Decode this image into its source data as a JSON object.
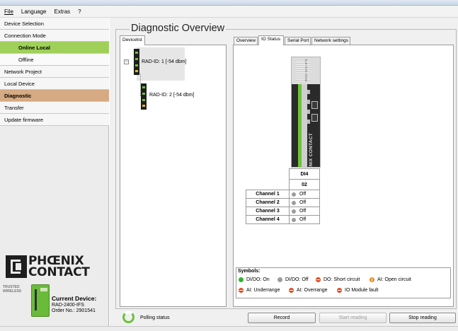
{
  "menu": [
    "File",
    "Language",
    "Extras",
    "?"
  ],
  "sidebar": {
    "items": [
      {
        "label": "Device Selection"
      },
      {
        "label": "Connection Mode"
      },
      {
        "label": "Online Local"
      },
      {
        "label": "Offline"
      },
      {
        "label": "Network Project"
      },
      {
        "label": "Local Device"
      },
      {
        "label": "Diagnostic"
      },
      {
        "label": "Transfer"
      },
      {
        "label": "Update firmware"
      }
    ],
    "logo": {
      "line1": "PHŒNIX",
      "line2": "CONTACT",
      "tagline": "TRUSTED WIRELESS"
    },
    "current_device": {
      "title": "Current Device:",
      "model": "RAD-2400-IFS",
      "order": "Order No.: 2901541"
    }
  },
  "main": {
    "title": "Diagnostic Overview",
    "devicelist_tab": "Devicelist",
    "tree": [
      {
        "label": "RAD-ID: 1 [-54 dbm]"
      },
      {
        "label": "RAD-ID: 2 [-54 dbm]"
      }
    ],
    "tabs": [
      {
        "label": "Overview"
      },
      {
        "label": "IO Status"
      },
      {
        "label": "Serial Port"
      },
      {
        "label": "Network settings"
      }
    ],
    "module": {
      "model_text": "RAD-DI4-IFS",
      "brand": "PHOENIX CONTACT"
    },
    "io_table": {
      "module_name": "DI4",
      "slot": "02",
      "channels": [
        {
          "name": "Channel 1",
          "state": "Off"
        },
        {
          "name": "Channel 2",
          "state": "Off"
        },
        {
          "name": "Channel 3",
          "state": "Off"
        },
        {
          "name": "Channel 4",
          "state": "Off"
        }
      ]
    },
    "symbols": {
      "title": "Symbols:",
      "items": [
        {
          "label": "DI/DO: On",
          "color": "#33b233",
          "icon": "green-dot-icon"
        },
        {
          "label": "DI/DO: Off",
          "color": "#9c9c9c",
          "icon": "gray-dot-icon"
        },
        {
          "label": "DO: Short circuit",
          "color": "#e04a1c",
          "icon": "red-error-icon"
        },
        {
          "label": "AI: Open circuit",
          "color": "#e6881a",
          "icon": "amber-warning-icon"
        },
        {
          "label": "AI: Underrange",
          "color": "#e04a1c",
          "icon": "red-error-icon"
        },
        {
          "label": "AI: Overrange",
          "color": "#e04a1c",
          "icon": "red-error-icon"
        },
        {
          "label": "IO Module fault",
          "color": "#e04a1c",
          "icon": "red-error-icon"
        }
      ]
    }
  },
  "footer": {
    "polling_label": "Polling status",
    "record_button": "Record",
    "start_button": "Start reading",
    "stop_button": "Stop reading"
  },
  "colors": {
    "nav_active_green": "#9fd15a",
    "nav_active_orange": "#d6aa82",
    "brand_green": "#6cc23a"
  }
}
